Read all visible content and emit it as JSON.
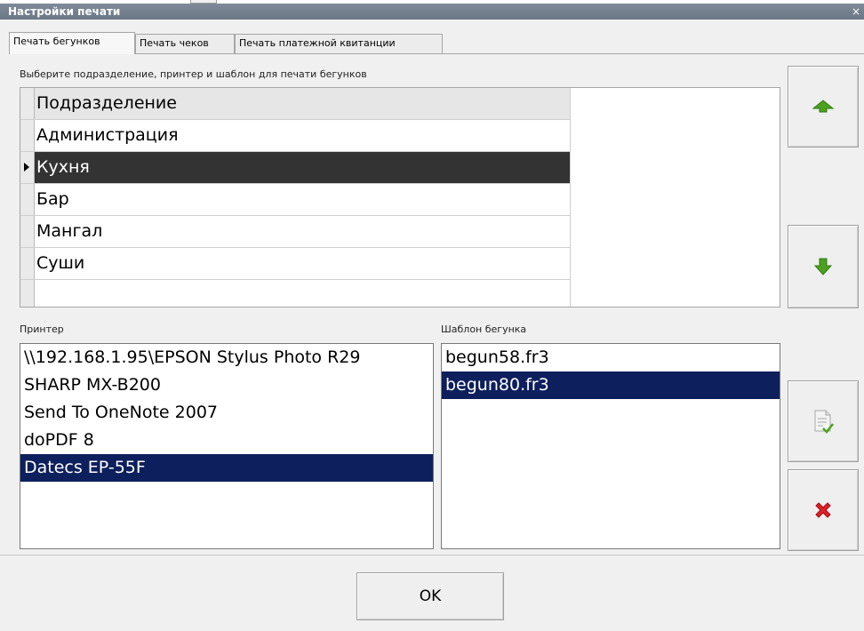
{
  "window": {
    "title": "Настройки печати",
    "close_glyph": "×"
  },
  "tabs": [
    {
      "label": "Печать бегунков",
      "active": true
    },
    {
      "label": "Печать чеков",
      "active": false
    },
    {
      "label": "Печать платежной квитанции",
      "active": false
    }
  ],
  "instruction": "Выберите подразделение, принтер и шаблон для печати бегунков",
  "departments": {
    "header": "Подразделение",
    "rows": [
      "Администрация",
      "Кухня",
      "Бар",
      "Мангал",
      "Суши"
    ],
    "selected": "Кухня"
  },
  "printer": {
    "label": "Принтер",
    "items": [
      "\\\\192.168.1.95\\EPSON Stylus Photo R29",
      "SHARP MX-B200",
      "Send To OneNote 2007",
      "doPDF 8",
      "Datecs EP-55F"
    ],
    "selected": "Datecs EP-55F"
  },
  "template": {
    "label": "Шаблон бегунка",
    "items": [
      "begun58.fr3",
      "begun80.fr3"
    ],
    "selected": "begun80.fr3"
  },
  "buttons": {
    "ok_label": "OK",
    "move_up_icon": "arrow-up-icon",
    "move_down_icon": "arrow-down-icon",
    "apply_icon": "document-check-icon",
    "delete_icon": "red-x-icon"
  },
  "colors": {
    "selection_dark": "#333333",
    "selection_list": "#0d1f5c",
    "arrow_green": "#4ca21e",
    "delete_red": "#e0202a"
  }
}
